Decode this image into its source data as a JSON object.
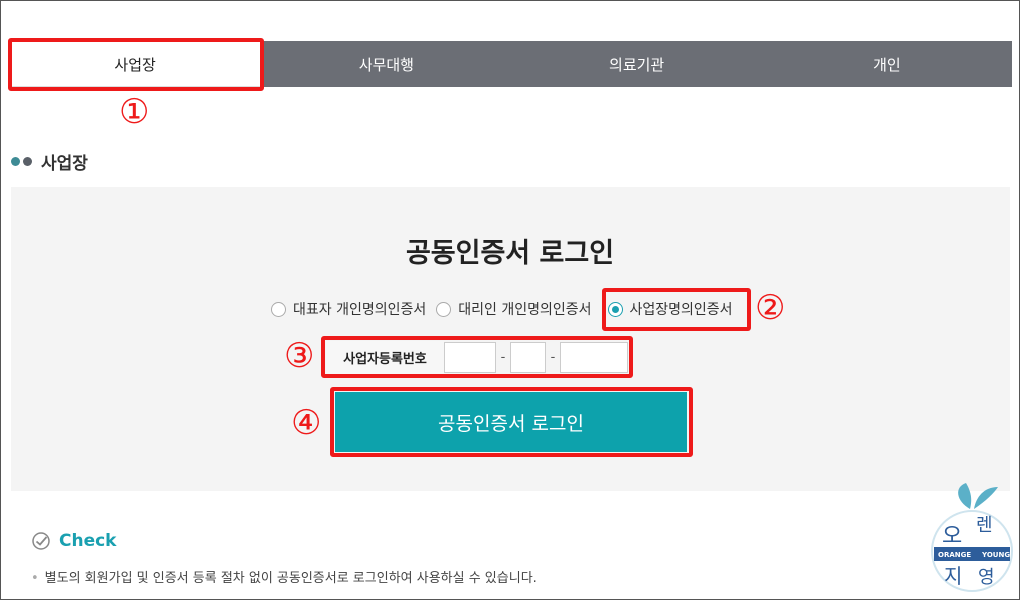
{
  "tabs": [
    {
      "label": "사업장",
      "active": true
    },
    {
      "label": "사무대행",
      "active": false
    },
    {
      "label": "의료기관",
      "active": false
    },
    {
      "label": "개인",
      "active": false
    }
  ],
  "markers": [
    "①",
    "②",
    "③",
    "④"
  ],
  "section": {
    "title": "사업장"
  },
  "login": {
    "title": "공동인증서 로그인",
    "cert_options": [
      {
        "label": "대표자 개인명의인증서",
        "checked": false
      },
      {
        "label": "대리인 개인명의인증서",
        "checked": false
      },
      {
        "label": "사업장명의인증서",
        "checked": true
      }
    ],
    "bizno_label": "사업자등록번호",
    "bizno_parts": [
      "",
      "",
      ""
    ],
    "separator": "-",
    "button_label": "공동인증서 로그인"
  },
  "check": {
    "title": "Check",
    "note": "별도의 회원가입 및 인증서 등록 절차 없이 공동인증서로 로그인하여 사용하실 수 있습니다."
  },
  "logo": {
    "top": "렌",
    "left": "오",
    "bottom_left": "지",
    "bottom_right": "영",
    "band_left": "ORANGE",
    "band_right": "YOUNG"
  },
  "colors": {
    "accent": "#0da2ac",
    "tab_bg": "#6b6e75",
    "highlight": "#ee1a1a"
  }
}
